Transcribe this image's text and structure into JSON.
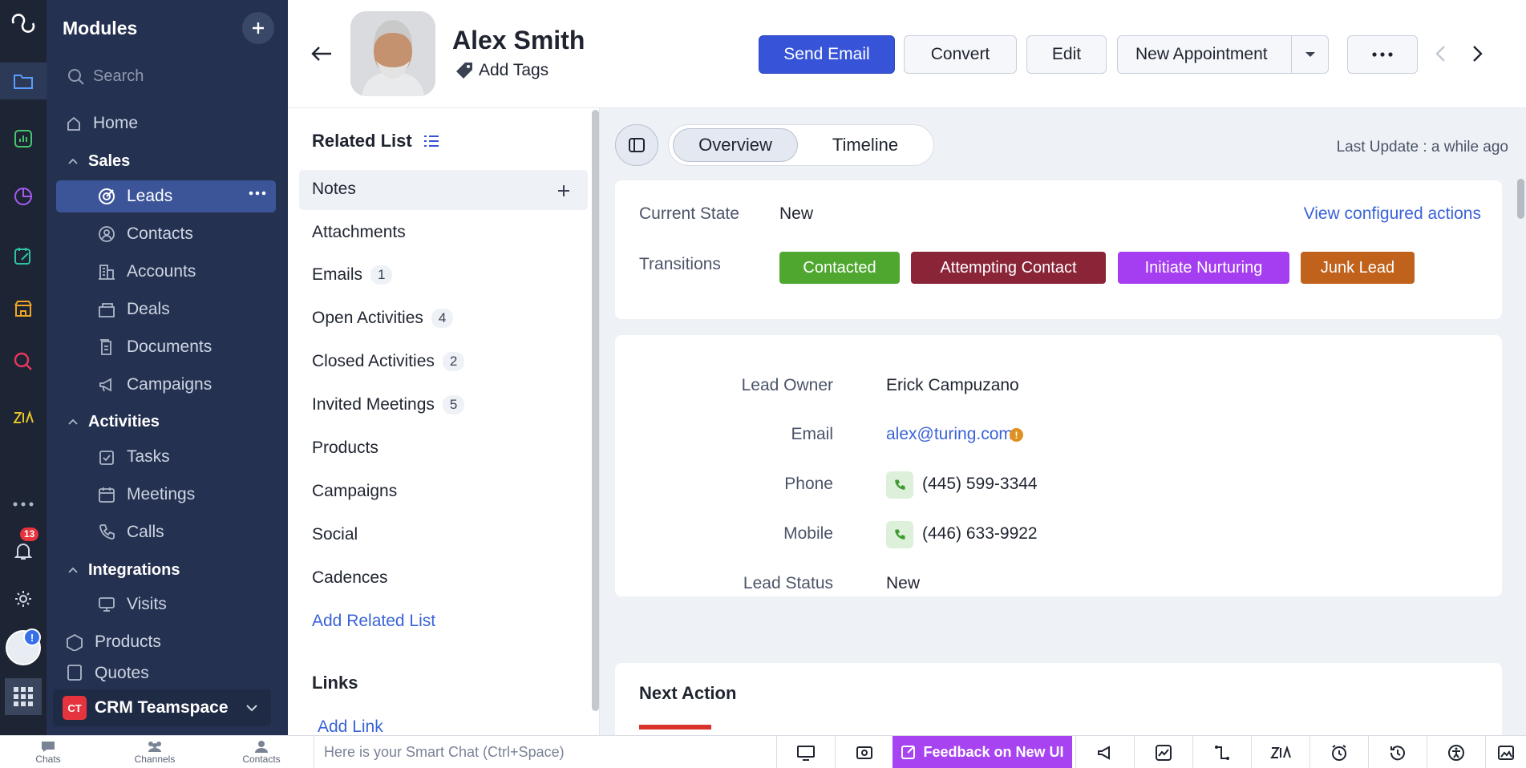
{
  "rail": {
    "notification_count": "13",
    "icons": [
      "modules-icon",
      "analytics-icon",
      "reports-icon",
      "forms-icon",
      "marketplace-icon",
      "search-icon",
      "zia-icon",
      "more-icon",
      "bell-icon",
      "settings-icon",
      "avatar",
      "apps-grid-icon"
    ]
  },
  "nav": {
    "title": "Modules",
    "search_placeholder": "Search",
    "home": "Home",
    "sales": "Sales",
    "items_sales": [
      "Leads",
      "Contacts",
      "Accounts",
      "Deals",
      "Documents",
      "Campaigns"
    ],
    "activities": "Activities",
    "items_activities": [
      "Tasks",
      "Meetings",
      "Calls"
    ],
    "integrations": "Integrations",
    "visits": "Visits",
    "products": "Products",
    "quotes": "Quotes",
    "teamspace_abbr": "CT",
    "teamspace": "CRM Teamspace"
  },
  "header": {
    "name": "Alex Smith",
    "add_tags": "Add Tags",
    "send_email": "Send Email",
    "convert": "Convert",
    "edit": "Edit",
    "new_appointment": "New Appointment"
  },
  "related": {
    "title": "Related List",
    "items": [
      {
        "label": "Notes",
        "count": ""
      },
      {
        "label": "Attachments",
        "count": ""
      },
      {
        "label": "Emails",
        "count": "1"
      },
      {
        "label": "Open Activities",
        "count": "4"
      },
      {
        "label": "Closed Activities",
        "count": "2"
      },
      {
        "label": "Invited Meetings",
        "count": "5"
      },
      {
        "label": "Products",
        "count": ""
      },
      {
        "label": "Campaigns",
        "count": ""
      },
      {
        "label": "Social",
        "count": ""
      },
      {
        "label": "Cadences",
        "count": ""
      }
    ],
    "add_related": "Add Related List",
    "links_title": "Links",
    "add_link": "Add Link"
  },
  "main": {
    "tab_overview": "Overview",
    "tab_timeline": "Timeline",
    "last_update": "Last Update : a while ago",
    "current_state_label": "Current State",
    "current_state_value": "New",
    "view_actions": "View configured actions",
    "transitions_label": "Transitions",
    "transitions": [
      {
        "label": "Contacted",
        "color": "#4fa72f"
      },
      {
        "label": "Attempting Contact",
        "color": "#8a2538"
      },
      {
        "label": "Initiate Nurturing",
        "color": "#a53ef0"
      },
      {
        "label": "Junk Lead",
        "color": "#c0611c"
      }
    ],
    "fields": {
      "lead_owner_label": "Lead Owner",
      "lead_owner": "Erick Campuzano",
      "email_label": "Email",
      "email": "alex@turing.com",
      "phone_label": "Phone",
      "phone": "(445) 599-3344",
      "mobile_label": "Mobile",
      "mobile": "(446) 633-9922",
      "status_label": "Lead Status",
      "status": "New"
    },
    "next_action": "Next Action"
  },
  "bottom": {
    "chats": "Chats",
    "channels": "Channels",
    "contacts": "Contacts",
    "smart_chat_placeholder": "Here is your Smart Chat (Ctrl+Space)",
    "feedback": "Feedback on New UI"
  },
  "colors": {
    "accent": "#3754d8",
    "link": "#3a63d8"
  }
}
